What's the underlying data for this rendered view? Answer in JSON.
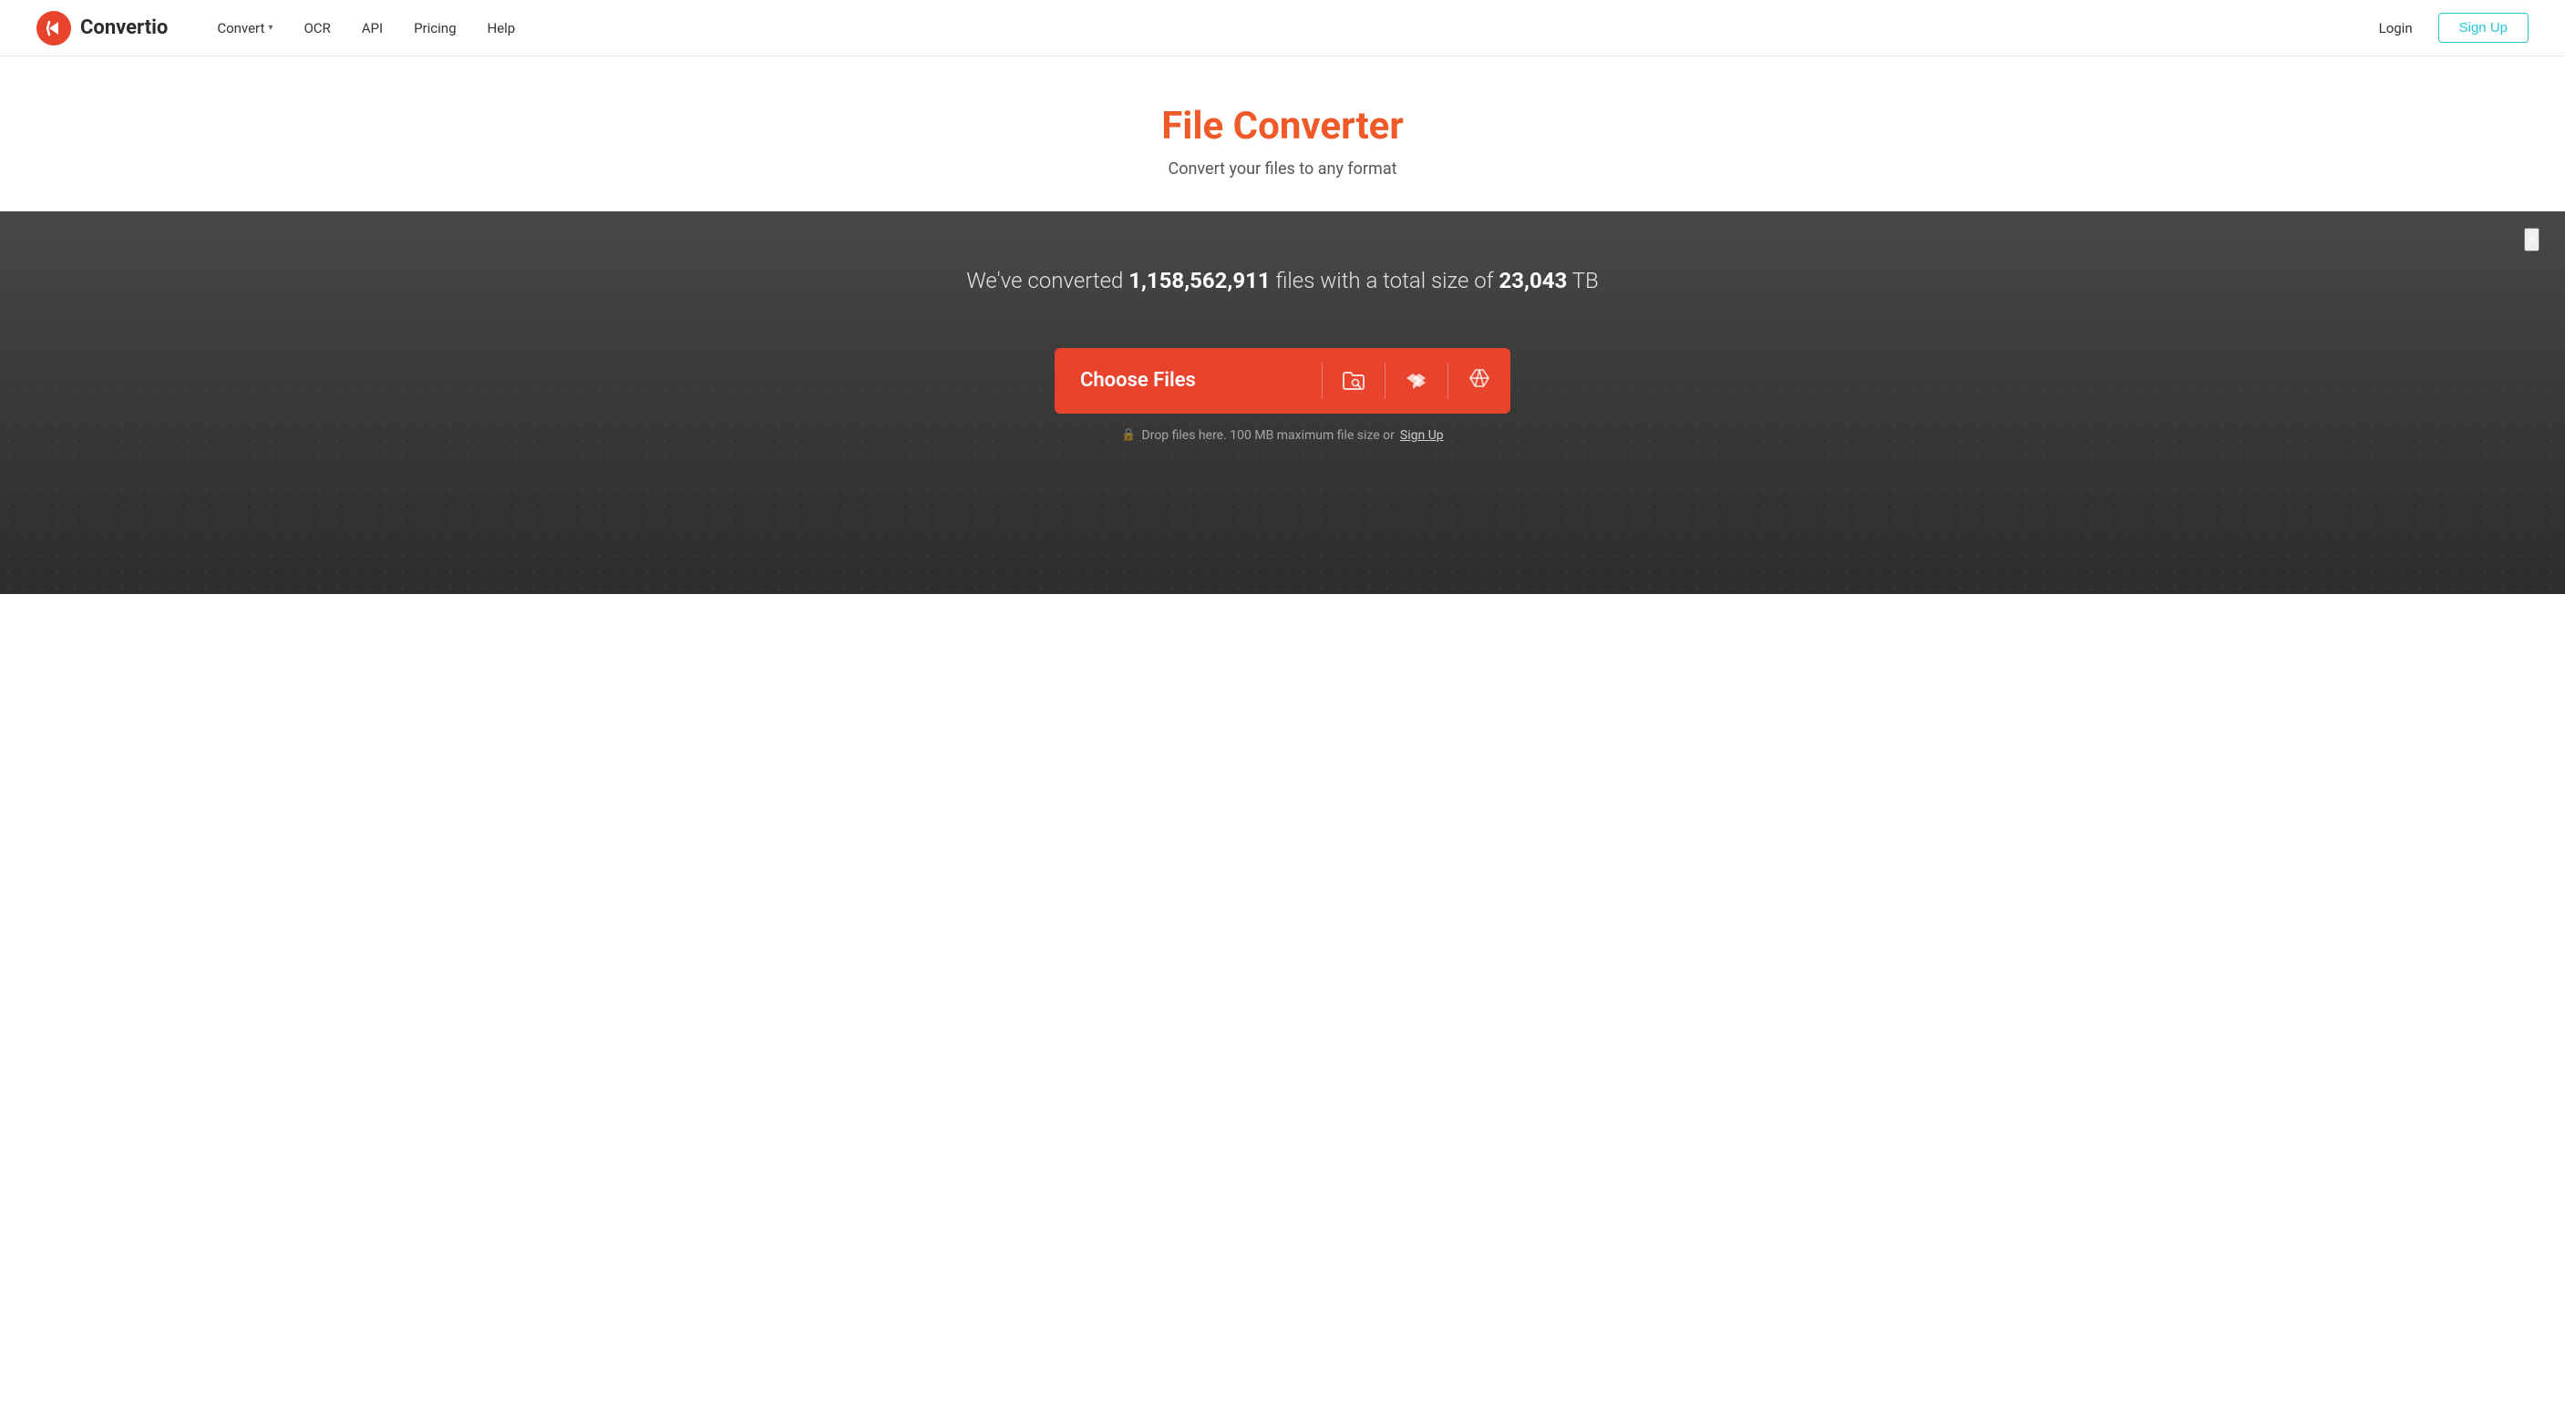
{
  "header": {
    "logo_text": "Convertio",
    "nav": [
      {
        "id": "convert",
        "label": "Convert",
        "has_dropdown": true
      },
      {
        "id": "ocr",
        "label": "OCR",
        "has_dropdown": false
      },
      {
        "id": "api",
        "label": "API",
        "has_dropdown": false
      },
      {
        "id": "pricing",
        "label": "Pricing",
        "has_dropdown": false
      },
      {
        "id": "help",
        "label": "Help",
        "has_dropdown": false
      }
    ],
    "login_label": "Login",
    "signup_label": "Sign Up"
  },
  "hero": {
    "title": "File Converter",
    "subtitle": "Convert your files to any format"
  },
  "converter": {
    "stats_prefix": "We've converted ",
    "stats_count": "1,158,562,911",
    "stats_middle": " files with a total size of ",
    "stats_size": "23,043",
    "stats_suffix": " TB",
    "choose_files_label": "Choose Files",
    "drop_hint_prefix": "Drop files here. 100 MB maximum file size or ",
    "drop_hint_link": "Sign Up",
    "close_label": "×",
    "icons": {
      "folder": "folder-with-search",
      "dropbox": "dropbox",
      "drive": "google-drive"
    }
  },
  "colors": {
    "brand_red": "#f05a28",
    "button_red": "#e8432d",
    "teal": "#26c6da"
  }
}
